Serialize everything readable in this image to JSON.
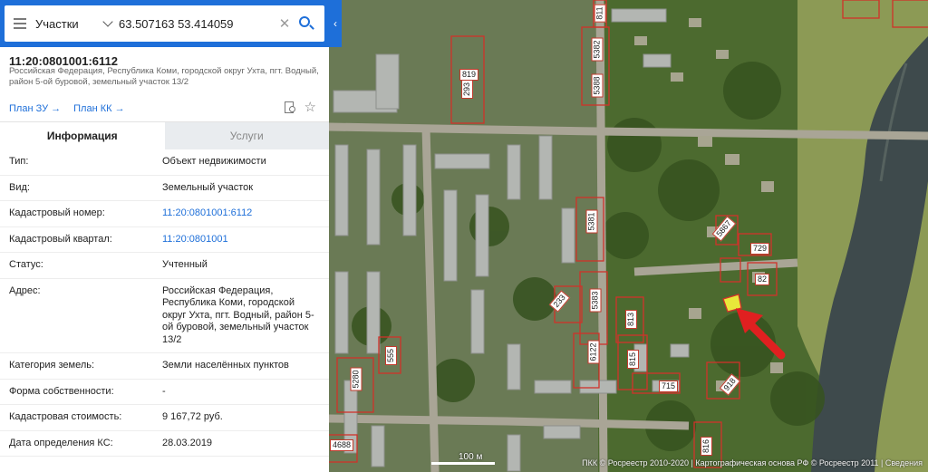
{
  "search": {
    "layer": "Участки",
    "query": "63.507163 53.414059"
  },
  "object": {
    "cadastral_number": "11:20:0801001:6112",
    "address_line": "Российская Федерация, Республика Коми, городской округ Ухта, пгт. Водный, район 5-ой буровой, земельный участок 13/2"
  },
  "plans": [
    {
      "label": "План ЗУ →"
    },
    {
      "label": "План КК →"
    }
  ],
  "tabs": [
    {
      "label": "Информация",
      "active": true
    },
    {
      "label": "Услуги",
      "active": false
    }
  ],
  "properties": [
    {
      "key": "Тип:",
      "value": "Объект недвижимости"
    },
    {
      "key": "Вид:",
      "value": "Земельный участок"
    },
    {
      "key": "Кадастровый номер:",
      "value": "11:20:0801001:6112",
      "link": true
    },
    {
      "key": "Кадастровый квартал:",
      "value": "11:20:0801001",
      "link": true
    },
    {
      "key": "Статус:",
      "value": "Учтенный"
    },
    {
      "key": "Адрес:",
      "value": "Российская Федерация, Республика Коми, городской округ Ухта, пгт. Водный, район 5-ой буровой, земельный участок 13/2"
    },
    {
      "key": "Категория земель:",
      "value": "Земли населённых пунктов"
    },
    {
      "key": "Форма собственности:",
      "value": "-"
    },
    {
      "key": "Кадастровая стоимость:",
      "value": "9 167,72 руб."
    },
    {
      "key": "Дата определения КС:",
      "value": "28.03.2019"
    }
  ],
  "map": {
    "plot_labels": [
      "819",
      "293",
      "5382",
      "5388",
      "811",
      "5381",
      "5383",
      "5867",
      "729",
      "233",
      "813",
      "815",
      "6122",
      "715",
      "555",
      "5280",
      "918",
      "816",
      "4688",
      "82"
    ],
    "scale": "100 м",
    "attribution": "ПКК © Росреестр 2010-2020 | Картографическая основа РФ © Росреестр 2011 | Сведения"
  },
  "colors": {
    "accent": "#1e6fd9",
    "parcel_border": "#c0392b",
    "highlight_parcel": "#e8e83a",
    "arrow": "#e02020"
  },
  "icons": [
    "menu-icon",
    "chevron-down-icon",
    "clear-icon",
    "search-icon",
    "chevron-left-icon",
    "zoom-doc-icon",
    "star-icon",
    "arrow-icon"
  ]
}
